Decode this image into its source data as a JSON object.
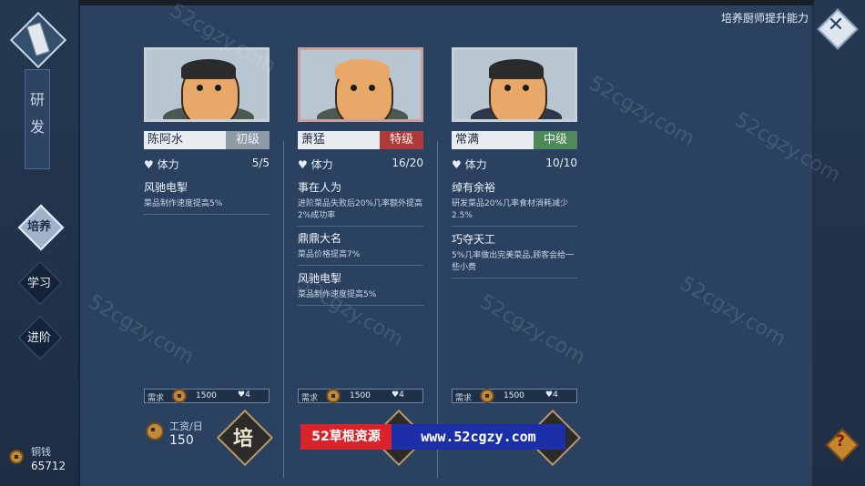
{
  "sidebar": {
    "vertical_tab": "研发",
    "nav": [
      "培养",
      "学习",
      "进阶"
    ],
    "currency_label": "铜钱",
    "currency_value": "65712"
  },
  "header": {
    "title": "培养厨师提升能力"
  },
  "chefs": [
    {
      "name": "陈阿水",
      "rank": "初级",
      "stamina_label": "体力",
      "stamina": "5/5",
      "skills": [
        {
          "name": "风驰电掣",
          "desc": "菜品制作速度提高5%"
        }
      ],
      "req_label": "需求",
      "req_coin": "1500",
      "req_heart": "4",
      "wage_label": "工资/日",
      "wage": "150",
      "train_label": "培"
    },
    {
      "name": "萧猛",
      "rank": "特级",
      "stamina_label": "体力",
      "stamina": "16/20",
      "skills": [
        {
          "name": "事在人为",
          "desc": "进阶菜品失败后20%几率额外提高2%成功率"
        },
        {
          "name": "鼎鼎大名",
          "desc": "菜品价格提高7%"
        },
        {
          "name": "风驰电掣",
          "desc": "菜品制作速度提高5%"
        }
      ],
      "req_label": "需求",
      "req_coin": "1500",
      "req_heart": "4"
    },
    {
      "name": "常满",
      "rank": "中级",
      "stamina_label": "体力",
      "stamina": "10/10",
      "skills": [
        {
          "name": "绰有余裕",
          "desc": "研发菜品20%几率食材消耗减少2.5%"
        },
        {
          "name": "巧夺天工",
          "desc": "5%几率做出完美菜品,顾客会给一些小费"
        }
      ],
      "req_label": "需求",
      "req_coin": "1500",
      "req_heart": "4"
    }
  ],
  "watermark": {
    "left": "52草根资源",
    "right": "www.52cgzy.com",
    "tile": "52cgzy.com"
  },
  "icons": {
    "close": "close-icon",
    "help": "help-icon",
    "coin": "coin-icon",
    "heart": "heart-icon"
  },
  "colors": {
    "background": "#2a4260",
    "rank_basic": "#8e9aa6",
    "rank_special": "#b03a3a",
    "rank_mid": "#4f8a5a",
    "banner_red": "#d8232a",
    "banner_blue": "#1d2fa8"
  }
}
